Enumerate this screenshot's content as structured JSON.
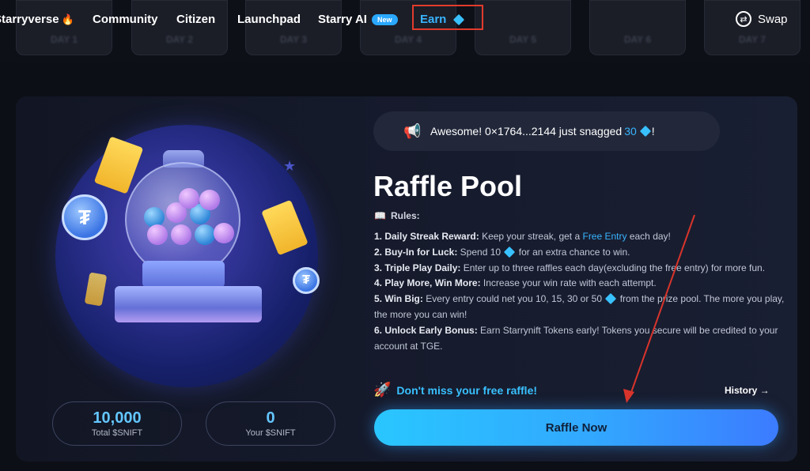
{
  "nav": {
    "ghost_labels": [
      "DAY 1",
      "DAY 2",
      "DAY 3",
      "DAY 4",
      "DAY 5",
      "DAY 6",
      "DAY 7"
    ],
    "items": {
      "starryverse": "Starryverse",
      "community": "Community",
      "citizen": "Citizen",
      "launchpad": "Launchpad",
      "starry_ai": "Starry AI",
      "starry_ai_badge": "New",
      "earn": "Earn",
      "swap": "Swap"
    }
  },
  "ticker": {
    "prefix": "Awesome! 0×1764...2144 just snagged",
    "amount": "30",
    "suffix": "!"
  },
  "raffle": {
    "title": "Raffle Pool",
    "rules_heading": "Rules:",
    "rules": [
      {
        "label": "1. Daily Streak Reward:",
        "text_a": " Keep your streak, get a ",
        "highlight": "Free Entry",
        "text_b": " each day!"
      },
      {
        "label": "2. Buy-In for Luck:",
        "text_a": " Spend 10 ",
        "text_b": " for an extra chance to win."
      },
      {
        "label": "3. Triple Play Daily:",
        "text_a": " Enter up to three raffles each day(excluding the free entry) for more fun."
      },
      {
        "label": "4. Play More, Win More:",
        "text_a": " Increase your win rate with each attempt."
      },
      {
        "label": "5. Win Big:",
        "text_a": " Every entry could net you 10, 15, 30 or 50 ",
        "text_b": " from the prize pool. The more you play, the more you can win!"
      },
      {
        "label": "6. Unlock Early Bonus:",
        "text_a": " Earn Starrynift Tokens early! Tokens you secure will be credited to your account at TGE."
      }
    ],
    "free_raffle_text": "Don't miss your free raffle!",
    "history_label": "History →",
    "raffle_button": "Raffle Now"
  },
  "stats": {
    "total_value": "10,000",
    "total_label": "Total $SNIFT",
    "yours_value": "0",
    "yours_label": "Your $SNIFT"
  },
  "colors": {
    "accent": "#39b4ff",
    "highlight_box": "#e23b2c",
    "annotation_arrow": "#d8342b"
  }
}
